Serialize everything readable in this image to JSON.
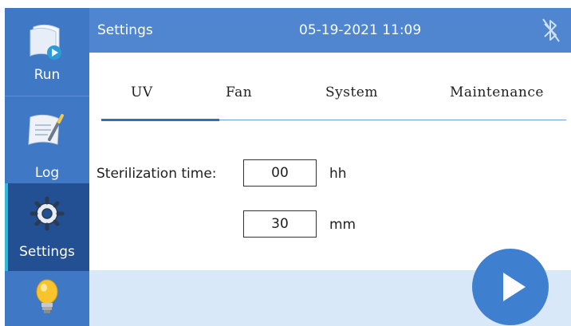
{
  "sidebar": {
    "items": [
      {
        "label": "Run",
        "icon": "run-document-icon"
      },
      {
        "label": "Log",
        "icon": "log-notebook-icon"
      },
      {
        "label": "Settings",
        "icon": "gear-icon",
        "active": true
      },
      {
        "label": "",
        "icon": "lightbulb-icon"
      }
    ]
  },
  "header": {
    "title": "Settings",
    "datetime": "05-19-2021 11:09",
    "status_icon": "bluetooth-off-icon"
  },
  "tabs": [
    {
      "label": "UV",
      "active": true
    },
    {
      "label": "Fan"
    },
    {
      "label": "System"
    },
    {
      "label": "Maintenance"
    }
  ],
  "uv": {
    "sterilization_label": "Sterilization time:",
    "hours_value": "00",
    "hours_unit": "hh",
    "minutes_value": "30",
    "minutes_unit": "mm"
  },
  "play": {
    "icon": "play-icon"
  },
  "colors": {
    "sidebar": "#3f78c4",
    "sidebar_active": "#234f93",
    "header": "#4f86cf",
    "bottom_bar": "#d9e8f8",
    "accent": "#3f7fcf"
  }
}
